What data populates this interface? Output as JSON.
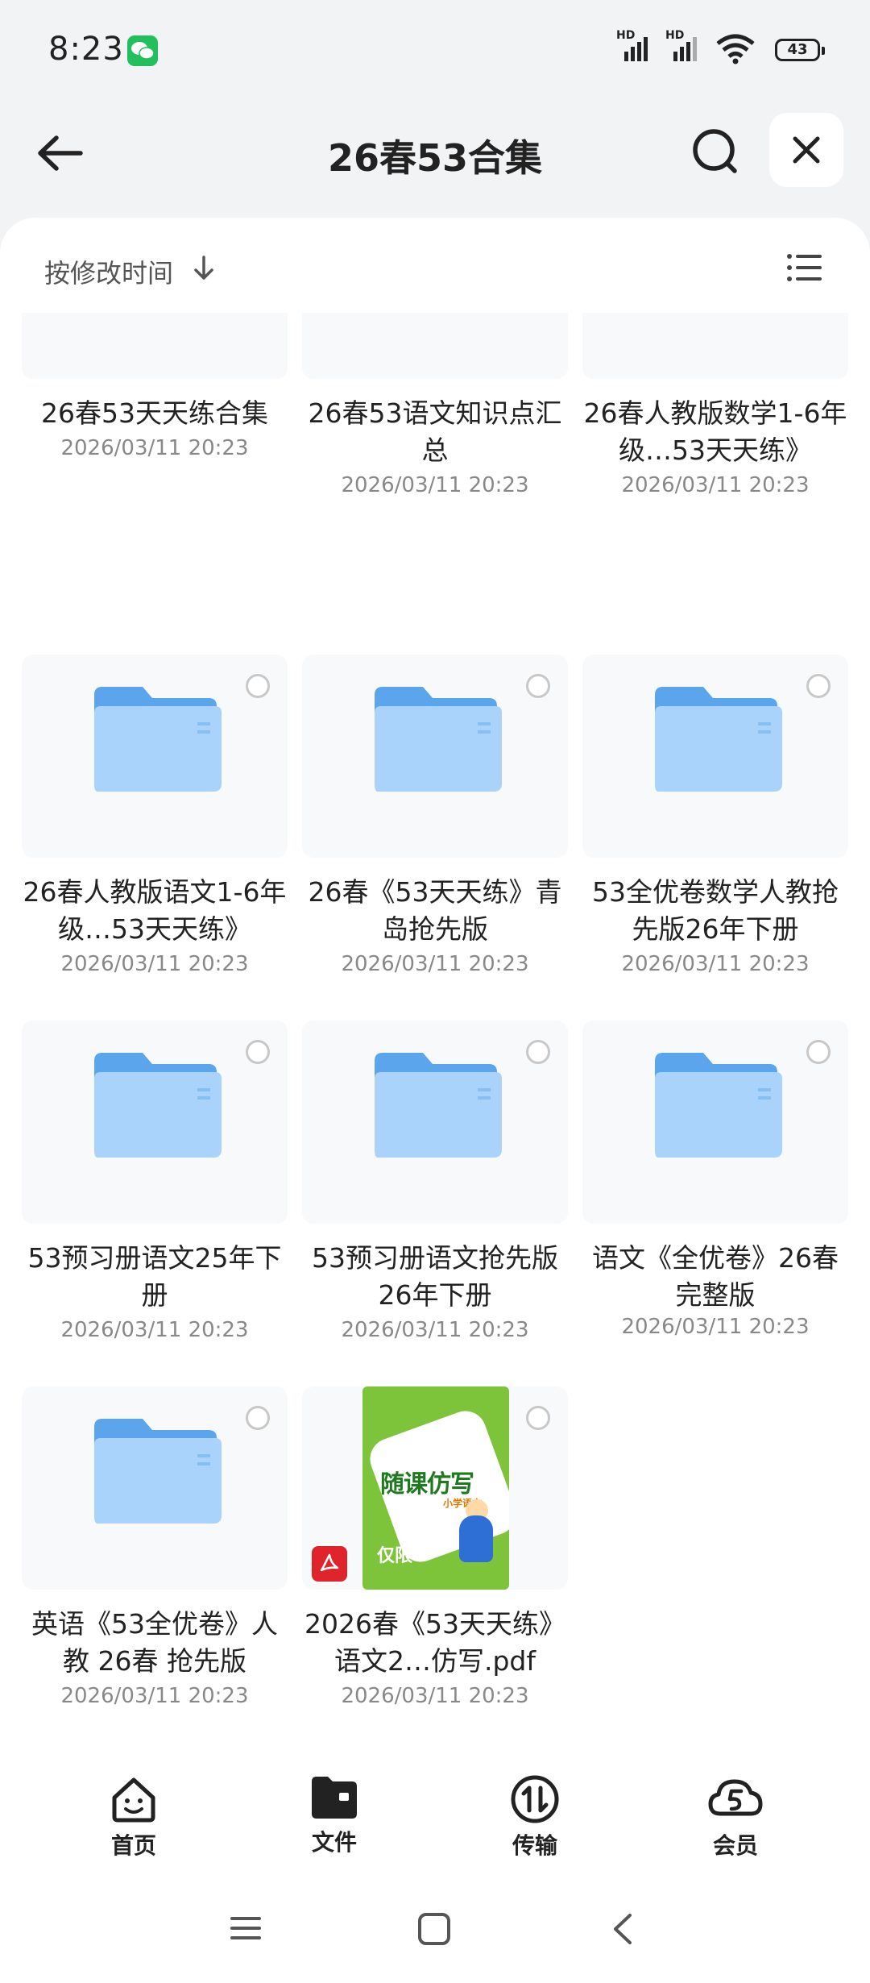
{
  "status": {
    "time": "8:23",
    "battery": "43",
    "hd1": "HD",
    "hd2": "HD"
  },
  "header": {
    "title": "26春53合集"
  },
  "sort": {
    "label": "按修改时间"
  },
  "items": [
    {
      "name": "26春53天天练合集",
      "date": "2026/03/11 20:23"
    },
    {
      "name": "26春53语文知识点汇总",
      "date": "2026/03/11 20:23"
    },
    {
      "name": "26春人教版数学1-6年级…53天天练》",
      "date": "2026/03/11 20:23"
    },
    {
      "name": "26春人教版语文1-6年级…53天天练》",
      "date": "2026/03/11 20:23"
    },
    {
      "name": "26春《53天天练》青岛抢先版",
      "date": "2026/03/11 20:23"
    },
    {
      "name": "53全优卷数学人教抢先版26年下册",
      "date": "2026/03/11 20:23"
    },
    {
      "name": "53预习册语文25年下册",
      "date": "2026/03/11 20:23"
    },
    {
      "name": "53预习册语文抢先版26年下册",
      "date": "2026/03/11 20:23"
    },
    {
      "name": "语文《全优卷》26春完整版",
      "date": "2026/03/11 20:23"
    },
    {
      "name": "英语《53全优卷》人教 26春 抢先版",
      "date": "2026/03/11 20:23"
    },
    {
      "name": "2026春《53天天练》语文2…仿写.pdf",
      "date": "2026/03/11 20:23"
    }
  ],
  "pdf_cover": {
    "title": "随课仿写",
    "tag": "小学语文",
    "banner": "仅限"
  },
  "nav": {
    "home": "首页",
    "files": "文件",
    "transfer": "传输",
    "member": "会员"
  },
  "colors": {
    "folder": "#6fb3f2",
    "accent": "#222222",
    "pdf_red": "#e0242c",
    "cover_green": "#7dc43a"
  }
}
